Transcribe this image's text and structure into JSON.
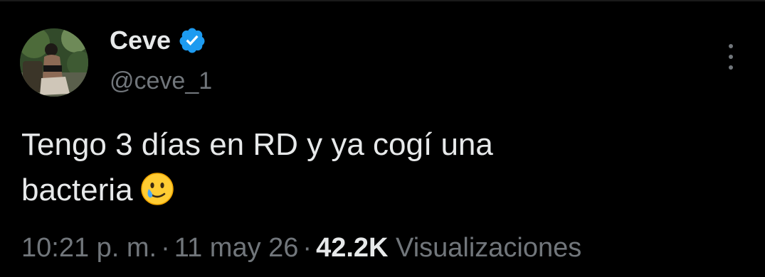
{
  "tweet": {
    "author": {
      "display_name": "Ceve",
      "handle": "@ceve_1",
      "verified_icon": "verified-badge-icon",
      "verified_color": "#1d9bf0"
    },
    "text_line1": "Tengo 3 días en RD y ya cogí una",
    "text_line2": "bacteria",
    "emoji": "smiling-face-with-tear-icon",
    "time": "10:21 p. m.",
    "separator": "·",
    "date": "11 may 26",
    "views_count": "42.2K",
    "views_label": "Visualizaciones"
  },
  "colors": {
    "background": "#000000",
    "text_primary": "#e7e9ea",
    "text_secondary": "#71767b",
    "accent": "#1d9bf0"
  }
}
